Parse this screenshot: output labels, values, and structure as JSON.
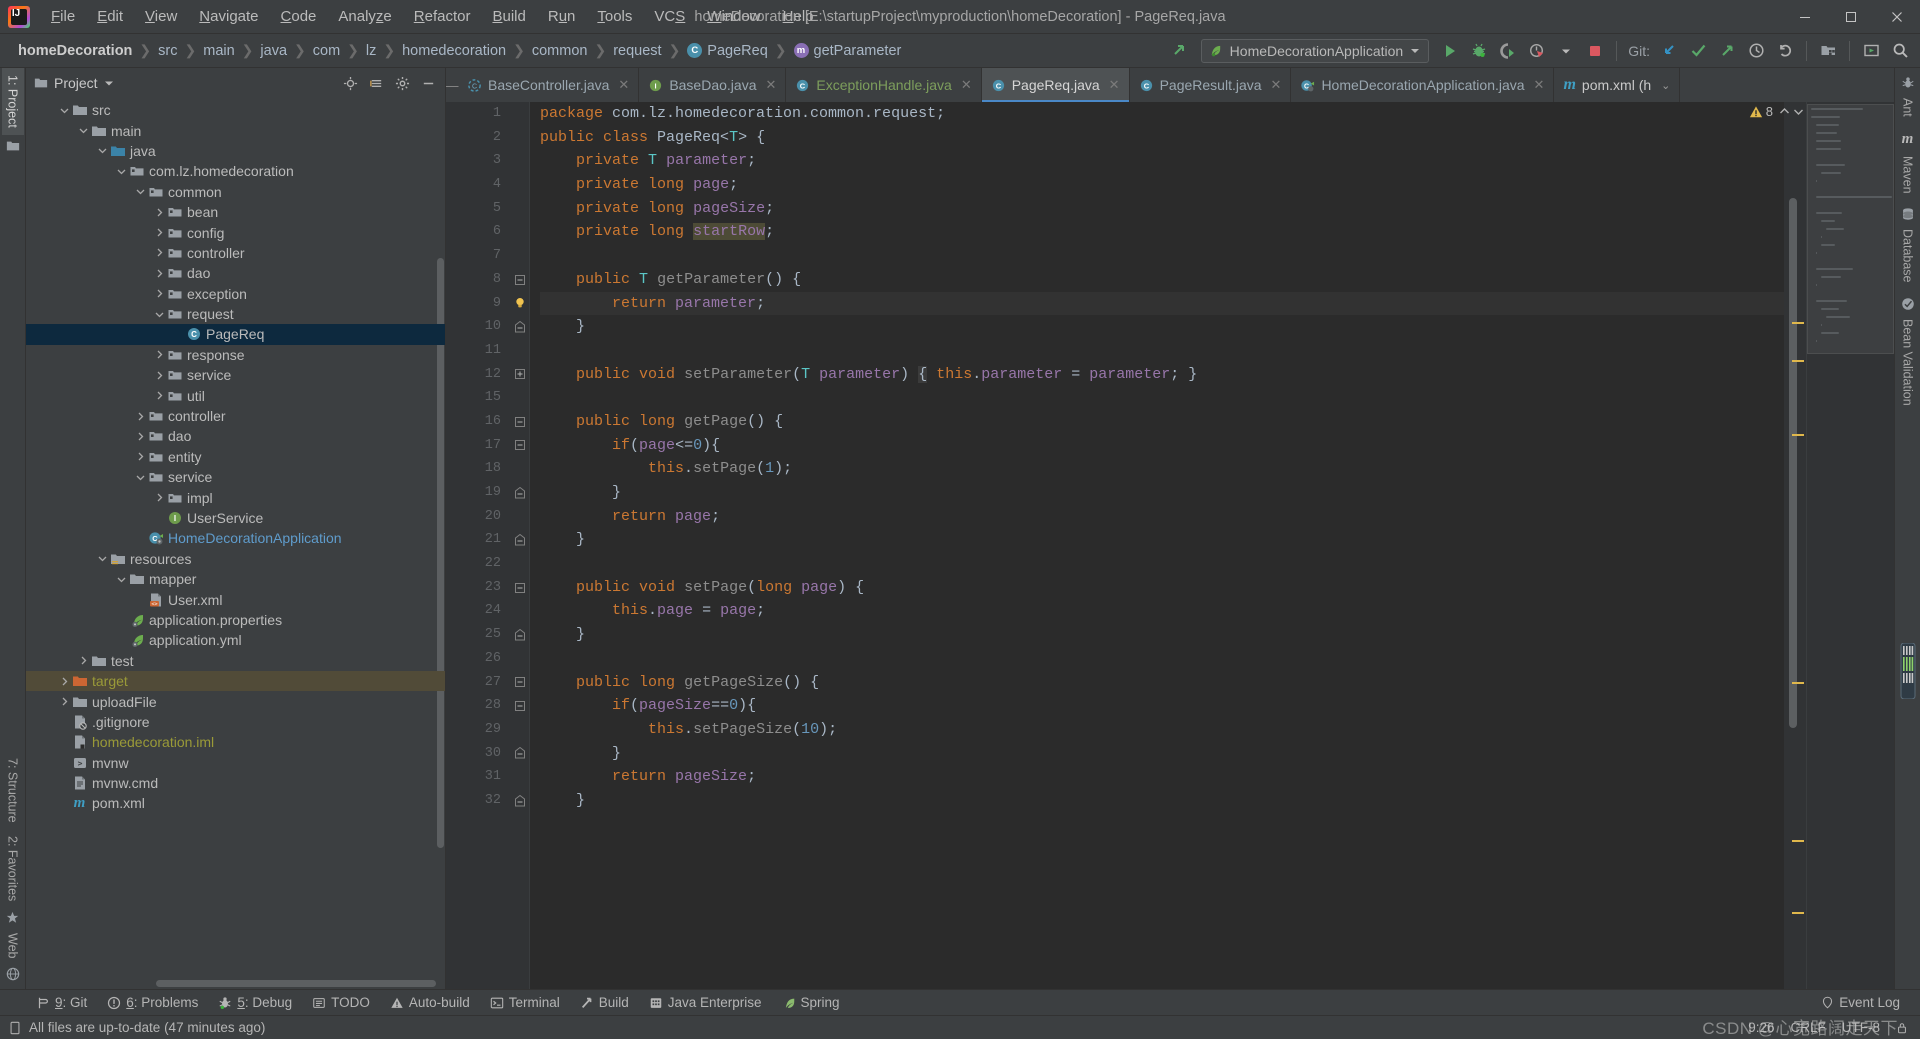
{
  "window": {
    "title": "homeDecoration [E:\\startupProject\\myproduction\\homeDecoration] - PageReq.java",
    "minimize": "—",
    "maximize": "❐",
    "close": "✕"
  },
  "menu": [
    {
      "label": "File",
      "mnemonic": "F"
    },
    {
      "label": "Edit",
      "mnemonic": "E"
    },
    {
      "label": "View",
      "mnemonic": "V"
    },
    {
      "label": "Navigate",
      "mnemonic": "N"
    },
    {
      "label": "Code",
      "mnemonic": "C"
    },
    {
      "label": "Analyze",
      "mnemonic": "z"
    },
    {
      "label": "Refactor",
      "mnemonic": "R"
    },
    {
      "label": "Build",
      "mnemonic": "B"
    },
    {
      "label": "Run",
      "mnemonic": "u"
    },
    {
      "label": "Tools",
      "mnemonic": "T"
    },
    {
      "label": "VCS",
      "mnemonic": "S"
    },
    {
      "label": "Window",
      "mnemonic": "W"
    },
    {
      "label": "Help",
      "mnemonic": "H"
    }
  ],
  "breadcrumbs": [
    {
      "label": "homeDecoration",
      "icon": "none",
      "bold": true
    },
    {
      "label": "src",
      "icon": "none",
      "bold": false
    },
    {
      "label": "main",
      "icon": "none",
      "bold": false
    },
    {
      "label": "java",
      "icon": "none",
      "bold": false
    },
    {
      "label": "com",
      "icon": "none",
      "bold": false
    },
    {
      "label": "lz",
      "icon": "none",
      "bold": false
    },
    {
      "label": "homedecoration",
      "icon": "none",
      "bold": false
    },
    {
      "label": "common",
      "icon": "none",
      "bold": false
    },
    {
      "label": "request",
      "icon": "none",
      "bold": false
    },
    {
      "label": "PageReq",
      "icon": "class",
      "bold": false
    },
    {
      "label": "getParameter",
      "icon": "method",
      "bold": false
    }
  ],
  "toolbar": {
    "run_config": "HomeDecorationApplication",
    "git_label": "Git:",
    "buttons": [
      {
        "name": "run",
        "title": "Run"
      },
      {
        "name": "debug",
        "title": "Debug"
      },
      {
        "name": "run-coverage",
        "title": "Run with Coverage"
      },
      {
        "name": "profiler",
        "title": "Profiler"
      },
      {
        "name": "stop",
        "title": "Stop"
      },
      {
        "name": "update-project",
        "title": "Update Project"
      },
      {
        "name": "commit",
        "title": "Commit"
      },
      {
        "name": "push",
        "title": "Push"
      },
      {
        "name": "history",
        "title": "History"
      },
      {
        "name": "rollback",
        "title": "Rollback"
      },
      {
        "name": "project-structure",
        "title": "Project Structure"
      },
      {
        "name": "select-open-file",
        "title": "Select Opened File"
      },
      {
        "name": "search-everywhere",
        "title": "Search Everywhere"
      }
    ]
  },
  "left_strip": {
    "top": [
      {
        "label": "1: Project",
        "mnemonic": "1",
        "active": true
      }
    ],
    "bottom": [
      {
        "label": "7: Structure",
        "mnemonic": "7"
      },
      {
        "label": "2: Favorites",
        "mnemonic": "2"
      },
      {
        "label": "Web",
        "mnemonic": ""
      }
    ]
  },
  "right_strip": [
    {
      "label": "Ant",
      "icon": "ant-icon"
    },
    {
      "label": "Maven",
      "icon": "maven-icon"
    },
    {
      "label": "Database",
      "icon": "database-icon"
    },
    {
      "label": "Bean Validation",
      "icon": "bean-validation-icon"
    }
  ],
  "project_panel": {
    "title": "Project",
    "actions": [
      "locate-icon",
      "collapse-all-icon",
      "settings-icon",
      "hide-icon"
    ],
    "tree": [
      {
        "indent": 1,
        "arrow": "down",
        "icon": "folder",
        "label": "src",
        "color": "normal",
        "state": "none"
      },
      {
        "indent": 2,
        "arrow": "down",
        "icon": "folder",
        "label": "main",
        "color": "normal",
        "state": "none"
      },
      {
        "indent": 3,
        "arrow": "down",
        "icon": "folder-src",
        "label": "java",
        "color": "normal",
        "state": "none"
      },
      {
        "indent": 4,
        "arrow": "down",
        "icon": "package",
        "label": "com.lz.homedecoration",
        "color": "normal",
        "state": "none"
      },
      {
        "indent": 5,
        "arrow": "down",
        "icon": "package",
        "label": "common",
        "color": "normal",
        "state": "none"
      },
      {
        "indent": 6,
        "arrow": "right",
        "icon": "package",
        "label": "bean",
        "color": "normal",
        "state": "none"
      },
      {
        "indent": 6,
        "arrow": "right",
        "icon": "package",
        "label": "config",
        "color": "normal",
        "state": "none"
      },
      {
        "indent": 6,
        "arrow": "right",
        "icon": "package",
        "label": "controller",
        "color": "normal",
        "state": "none"
      },
      {
        "indent": 6,
        "arrow": "right",
        "icon": "package",
        "label": "dao",
        "color": "normal",
        "state": "none"
      },
      {
        "indent": 6,
        "arrow": "right",
        "icon": "package",
        "label": "exception",
        "color": "normal",
        "state": "none"
      },
      {
        "indent": 6,
        "arrow": "down",
        "icon": "package",
        "label": "request",
        "color": "normal",
        "state": "none"
      },
      {
        "indent": 7,
        "arrow": "none",
        "icon": "class",
        "label": "PageReq",
        "color": "normal",
        "state": "selected"
      },
      {
        "indent": 6,
        "arrow": "right",
        "icon": "package",
        "label": "response",
        "color": "normal",
        "state": "none"
      },
      {
        "indent": 6,
        "arrow": "right",
        "icon": "package",
        "label": "service",
        "color": "normal",
        "state": "none"
      },
      {
        "indent": 6,
        "arrow": "right",
        "icon": "package",
        "label": "util",
        "color": "normal",
        "state": "none"
      },
      {
        "indent": 5,
        "arrow": "right",
        "icon": "package",
        "label": "controller",
        "color": "normal",
        "state": "none"
      },
      {
        "indent": 5,
        "arrow": "right",
        "icon": "package",
        "label": "dao",
        "color": "normal",
        "state": "none"
      },
      {
        "indent": 5,
        "arrow": "right",
        "icon": "package",
        "label": "entity",
        "color": "normal",
        "state": "none"
      },
      {
        "indent": 5,
        "arrow": "down",
        "icon": "package",
        "label": "service",
        "color": "normal",
        "state": "none"
      },
      {
        "indent": 6,
        "arrow": "right",
        "icon": "package",
        "label": "impl",
        "color": "normal",
        "state": "none"
      },
      {
        "indent": 6,
        "arrow": "none",
        "icon": "interface",
        "label": "UserService",
        "color": "normal",
        "state": "none"
      },
      {
        "indent": 5,
        "arrow": "none",
        "icon": "spring-class",
        "label": "HomeDecorationApplication",
        "color": "link",
        "state": "none"
      },
      {
        "indent": 3,
        "arrow": "down",
        "icon": "folder-res",
        "label": "resources",
        "color": "normal",
        "state": "none"
      },
      {
        "indent": 4,
        "arrow": "down",
        "icon": "folder",
        "label": "mapper",
        "color": "normal",
        "state": "none"
      },
      {
        "indent": 5,
        "arrow": "none",
        "icon": "xml",
        "label": "User.xml",
        "color": "normal",
        "state": "none"
      },
      {
        "indent": 4,
        "arrow": "none",
        "icon": "spring-file",
        "label": "application.properties",
        "color": "normal",
        "state": "none"
      },
      {
        "indent": 4,
        "arrow": "none",
        "icon": "spring-file",
        "label": "application.yml",
        "color": "normal",
        "state": "none"
      },
      {
        "indent": 2,
        "arrow": "right",
        "icon": "folder",
        "label": "test",
        "color": "normal",
        "state": "none"
      },
      {
        "indent": 1,
        "arrow": "right",
        "icon": "folder-excl",
        "label": "target",
        "color": "green",
        "state": "highlight"
      },
      {
        "indent": 1,
        "arrow": "right",
        "icon": "folder",
        "label": "uploadFile",
        "color": "normal",
        "state": "none"
      },
      {
        "indent": 1,
        "arrow": "none",
        "icon": "file-ignore",
        "label": ".gitignore",
        "color": "normal",
        "state": "none"
      },
      {
        "indent": 1,
        "arrow": "none",
        "icon": "file-iml",
        "label": "homedecoration.iml",
        "color": "green",
        "state": "none"
      },
      {
        "indent": 1,
        "arrow": "none",
        "icon": "file-sh",
        "label": "mvnw",
        "color": "normal",
        "state": "none"
      },
      {
        "indent": 1,
        "arrow": "none",
        "icon": "file-txt",
        "label": "mvnw.cmd",
        "color": "normal",
        "state": "none"
      },
      {
        "indent": 1,
        "arrow": "none",
        "icon": "maven-file",
        "label": "pom.xml",
        "color": "normal",
        "state": "none"
      }
    ]
  },
  "editor_tabs": [
    {
      "label": "BaseController.java",
      "icon": "class-abstract",
      "active": false,
      "color": "blue"
    },
    {
      "label": "BaseDao.java",
      "icon": "interface",
      "active": false,
      "color": "blue"
    },
    {
      "label": "ExceptionHandle.java",
      "icon": "class",
      "active": false,
      "color": "green"
    },
    {
      "label": "PageReq.java",
      "icon": "class",
      "active": true,
      "color": "white"
    },
    {
      "label": "PageResult.java",
      "icon": "class",
      "active": false,
      "color": "blue"
    },
    {
      "label": "HomeDecorationApplication.java",
      "icon": "spring-class",
      "active": false,
      "color": "blue"
    },
    {
      "label": "pom.xml (h",
      "icon": "maven",
      "active": false,
      "color": "white"
    }
  ],
  "editor": {
    "warning_count": "8",
    "lines": [
      {
        "num": "1",
        "fold": "none",
        "indent": 0,
        "cursor": false,
        "text": "package com.lz.homedecoration.common.request;"
      },
      {
        "num": "2",
        "fold": "none",
        "indent": 0,
        "cursor": false,
        "text": "public class PageReq<T> {"
      },
      {
        "num": "3",
        "fold": "none",
        "indent": 1,
        "cursor": false,
        "text": "private T parameter;"
      },
      {
        "num": "4",
        "fold": "none",
        "indent": 1,
        "cursor": false,
        "text": "private long page;"
      },
      {
        "num": "5",
        "fold": "none",
        "indent": 1,
        "cursor": false,
        "text": "private long pageSize;"
      },
      {
        "num": "6",
        "fold": "none",
        "indent": 1,
        "cursor": false,
        "text": "private long startRow;"
      },
      {
        "num": "7",
        "fold": "none",
        "indent": 0,
        "cursor": false,
        "text": ""
      },
      {
        "num": "8",
        "fold": "start",
        "indent": 1,
        "cursor": false,
        "text": "public T getParameter() {"
      },
      {
        "num": "9",
        "fold": "bulb",
        "indent": 2,
        "cursor": true,
        "text": "return parameter;"
      },
      {
        "num": "10",
        "fold": "end",
        "indent": 1,
        "cursor": false,
        "text": "}"
      },
      {
        "num": "11",
        "fold": "none",
        "indent": 0,
        "cursor": false,
        "text": ""
      },
      {
        "num": "12",
        "fold": "collapsed",
        "indent": 1,
        "cursor": false,
        "text": "public void setParameter(T parameter) { this.parameter = parameter; }"
      },
      {
        "num": "15",
        "fold": "none",
        "indent": 0,
        "cursor": false,
        "text": ""
      },
      {
        "num": "16",
        "fold": "start",
        "indent": 1,
        "cursor": false,
        "text": "public long getPage() {"
      },
      {
        "num": "17",
        "fold": "start",
        "indent": 2,
        "cursor": false,
        "text": "if(page<=0){"
      },
      {
        "num": "18",
        "fold": "none",
        "indent": 3,
        "cursor": false,
        "text": "this.setPage(1);"
      },
      {
        "num": "19",
        "fold": "end",
        "indent": 2,
        "cursor": false,
        "text": "}"
      },
      {
        "num": "20",
        "fold": "none",
        "indent": 2,
        "cursor": false,
        "text": "return page;"
      },
      {
        "num": "21",
        "fold": "end",
        "indent": 1,
        "cursor": false,
        "text": "}"
      },
      {
        "num": "22",
        "fold": "none",
        "indent": 0,
        "cursor": false,
        "text": ""
      },
      {
        "num": "23",
        "fold": "start",
        "indent": 1,
        "cursor": false,
        "text": "public void setPage(long page) {"
      },
      {
        "num": "24",
        "fold": "none",
        "indent": 2,
        "cursor": false,
        "text": "this.page = page;"
      },
      {
        "num": "25",
        "fold": "end",
        "indent": 1,
        "cursor": false,
        "text": "}"
      },
      {
        "num": "26",
        "fold": "none",
        "indent": 0,
        "cursor": false,
        "text": ""
      },
      {
        "num": "27",
        "fold": "start",
        "indent": 1,
        "cursor": false,
        "text": "public long getPageSize() {"
      },
      {
        "num": "28",
        "fold": "start",
        "indent": 2,
        "cursor": false,
        "text": "if(pageSize==0){"
      },
      {
        "num": "29",
        "fold": "none",
        "indent": 3,
        "cursor": false,
        "text": "this.setPageSize(10);"
      },
      {
        "num": "30",
        "fold": "end",
        "indent": 2,
        "cursor": false,
        "text": "}"
      },
      {
        "num": "31",
        "fold": "none",
        "indent": 2,
        "cursor": false,
        "text": "return pageSize;"
      },
      {
        "num": "32",
        "fold": "end",
        "indent": 1,
        "cursor": false,
        "text": "}"
      }
    ]
  },
  "tool_windows": [
    {
      "label": "9: Git",
      "mnemonic": "9",
      "icon": "git-icon"
    },
    {
      "label": "6: Problems",
      "mnemonic": "6",
      "icon": "problems-icon"
    },
    {
      "label": "5: Debug",
      "mnemonic": "5",
      "icon": "debug-icon"
    },
    {
      "label": "TODO",
      "mnemonic": "",
      "icon": "todo-icon"
    },
    {
      "label": "Auto-build",
      "mnemonic": "",
      "icon": "warning-icon"
    },
    {
      "label": "Terminal",
      "mnemonic": "",
      "icon": "terminal-icon"
    },
    {
      "label": "Build",
      "mnemonic": "",
      "icon": "build-icon"
    },
    {
      "label": "Java Enterprise",
      "mnemonic": "",
      "icon": "java-enterprise-icon"
    },
    {
      "label": "Spring",
      "mnemonic": "",
      "icon": "spring-icon"
    }
  ],
  "event_log": "Event Log",
  "status": {
    "message": "All files are up-to-date (47 minutes ago)",
    "caret": "9:26",
    "line_separator": "CRLF",
    "encoding": "UTF-8",
    "watermark": "CSDN @心宽路阔走天下"
  }
}
